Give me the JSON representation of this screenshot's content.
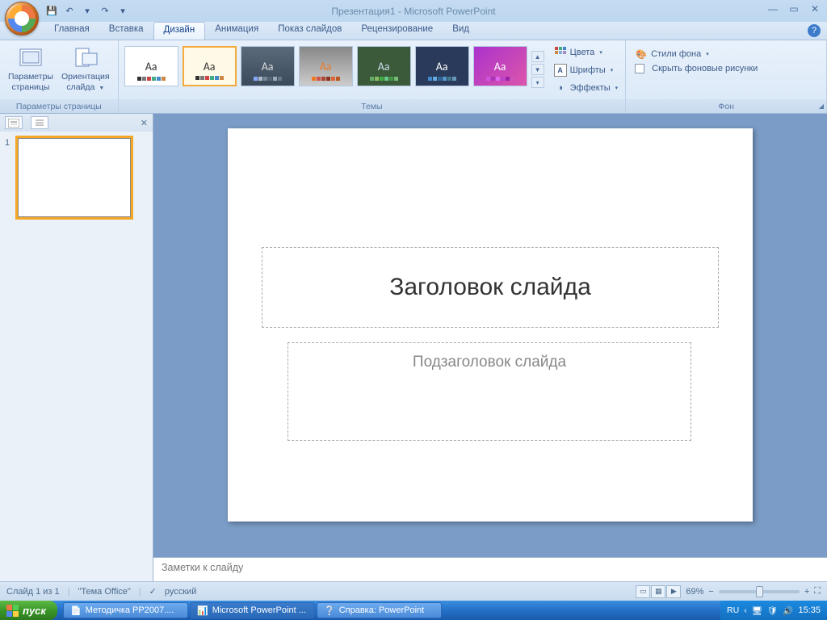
{
  "window": {
    "title": "Презентация1 - Microsoft PowerPoint"
  },
  "qat": {
    "save": "💾",
    "undo": "↶",
    "redo": "↷"
  },
  "tabs": {
    "home": "Главная",
    "insert": "Вставка",
    "design": "Дизайн",
    "animations": "Анимация",
    "slideshow": "Показ слайдов",
    "review": "Рецензирование",
    "view": "Вид"
  },
  "ribbon": {
    "page_setup": {
      "page_params": "Параметры\nстраницы",
      "orientation": "Ориентация\nслайда",
      "group_label": "Параметры страницы"
    },
    "themes": {
      "group_label": "Темы",
      "colors": "Цвета",
      "fonts": "Шрифты",
      "effects": "Эффекты"
    },
    "background": {
      "styles": "Стили фона",
      "hide_graphics": "Скрыть фоновые рисунки",
      "group_label": "Фон"
    }
  },
  "slide": {
    "title_placeholder": "Заголовок слайда",
    "subtitle_placeholder": "Подзаголовок слайда",
    "thumb_number": "1"
  },
  "notes": {
    "placeholder": "Заметки к слайду"
  },
  "status": {
    "slide_info": "Слайд 1 из 1",
    "theme": "\"Тема Office\"",
    "language": "русский",
    "zoom": "69%"
  },
  "taskbar": {
    "start": "пуск",
    "items": {
      "word": "Методичка PP2007....",
      "ppt": "Microsoft PowerPoint ...",
      "help": "Справка: PowerPoint"
    },
    "lang": "RU",
    "time": "15:35"
  }
}
